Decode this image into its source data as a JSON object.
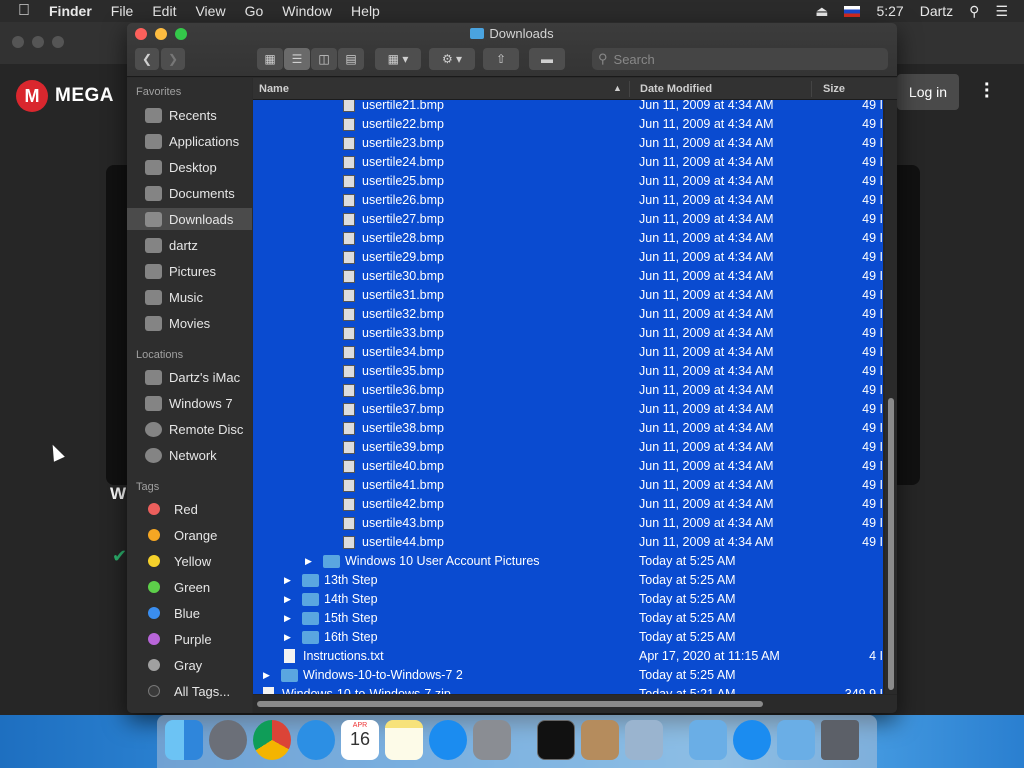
{
  "menubar": {
    "apple_icon": "apple-icon",
    "app_name": "Finder",
    "menus": [
      "File",
      "Edit",
      "View",
      "Go",
      "Window",
      "Help"
    ],
    "time": "5:27",
    "user": "Dartz"
  },
  "browser": {
    "logo_letter": "M",
    "logo_text": "MEGA",
    "login_label": "Log in",
    "panel_letter": "W"
  },
  "finder": {
    "title": "Downloads",
    "search_placeholder": "Search",
    "sidebar": {
      "favorites_header": "Favorites",
      "favorites": [
        "Recents",
        "Applications",
        "Desktop",
        "Documents",
        "Downloads",
        "dartz",
        "Pictures",
        "Music",
        "Movies"
      ],
      "selected": "Downloads",
      "locations_header": "Locations",
      "locations": [
        "Dartz's iMac",
        "Windows 7",
        "Remote Disc",
        "Network"
      ],
      "tags_header": "Tags",
      "tags": [
        {
          "label": "Red",
          "color": "#ec5f5c"
        },
        {
          "label": "Orange",
          "color": "#f5a623"
        },
        {
          "label": "Yellow",
          "color": "#f5d12b"
        },
        {
          "label": "Green",
          "color": "#5dcf4a"
        },
        {
          "label": "Blue",
          "color": "#3a8ef0"
        },
        {
          "label": "Purple",
          "color": "#b865d9"
        },
        {
          "label": "Gray",
          "color": "#a0a0a0"
        },
        {
          "label": "All Tags...",
          "color": "#3a3a3a"
        }
      ]
    },
    "columns": {
      "name": "Name",
      "date": "Date Modified",
      "size": "Size"
    },
    "rows": [
      {
        "name": "usertile21.bmp",
        "date": "Jun 11, 2009 at 4:34 AM",
        "size": "49 I",
        "kind": "file",
        "level": 3
      },
      {
        "name": "usertile22.bmp",
        "date": "Jun 11, 2009 at 4:34 AM",
        "size": "49 I",
        "kind": "file",
        "level": 3
      },
      {
        "name": "usertile23.bmp",
        "date": "Jun 11, 2009 at 4:34 AM",
        "size": "49 I",
        "kind": "file",
        "level": 3
      },
      {
        "name": "usertile24.bmp",
        "date": "Jun 11, 2009 at 4:34 AM",
        "size": "49 I",
        "kind": "file",
        "level": 3
      },
      {
        "name": "usertile25.bmp",
        "date": "Jun 11, 2009 at 4:34 AM",
        "size": "49 I",
        "kind": "file",
        "level": 3
      },
      {
        "name": "usertile26.bmp",
        "date": "Jun 11, 2009 at 4:34 AM",
        "size": "49 I",
        "kind": "file",
        "level": 3
      },
      {
        "name": "usertile27.bmp",
        "date": "Jun 11, 2009 at 4:34 AM",
        "size": "49 I",
        "kind": "file",
        "level": 3
      },
      {
        "name": "usertile28.bmp",
        "date": "Jun 11, 2009 at 4:34 AM",
        "size": "49 I",
        "kind": "file",
        "level": 3
      },
      {
        "name": "usertile29.bmp",
        "date": "Jun 11, 2009 at 4:34 AM",
        "size": "49 I",
        "kind": "file",
        "level": 3
      },
      {
        "name": "usertile30.bmp",
        "date": "Jun 11, 2009 at 4:34 AM",
        "size": "49 I",
        "kind": "file",
        "level": 3
      },
      {
        "name": "usertile31.bmp",
        "date": "Jun 11, 2009 at 4:34 AM",
        "size": "49 I",
        "kind": "file",
        "level": 3
      },
      {
        "name": "usertile32.bmp",
        "date": "Jun 11, 2009 at 4:34 AM",
        "size": "49 I",
        "kind": "file",
        "level": 3
      },
      {
        "name": "usertile33.bmp",
        "date": "Jun 11, 2009 at 4:34 AM",
        "size": "49 I",
        "kind": "file",
        "level": 3
      },
      {
        "name": "usertile34.bmp",
        "date": "Jun 11, 2009 at 4:34 AM",
        "size": "49 I",
        "kind": "file",
        "level": 3
      },
      {
        "name": "usertile35.bmp",
        "date": "Jun 11, 2009 at 4:34 AM",
        "size": "49 I",
        "kind": "file",
        "level": 3
      },
      {
        "name": "usertile36.bmp",
        "date": "Jun 11, 2009 at 4:34 AM",
        "size": "49 I",
        "kind": "file",
        "level": 3
      },
      {
        "name": "usertile37.bmp",
        "date": "Jun 11, 2009 at 4:34 AM",
        "size": "49 I",
        "kind": "file",
        "level": 3
      },
      {
        "name": "usertile38.bmp",
        "date": "Jun 11, 2009 at 4:34 AM",
        "size": "49 I",
        "kind": "file",
        "level": 3
      },
      {
        "name": "usertile39.bmp",
        "date": "Jun 11, 2009 at 4:34 AM",
        "size": "49 I",
        "kind": "file",
        "level": 3
      },
      {
        "name": "usertile40.bmp",
        "date": "Jun 11, 2009 at 4:34 AM",
        "size": "49 I",
        "kind": "file",
        "level": 3
      },
      {
        "name": "usertile41.bmp",
        "date": "Jun 11, 2009 at 4:34 AM",
        "size": "49 I",
        "kind": "file",
        "level": 3
      },
      {
        "name": "usertile42.bmp",
        "date": "Jun 11, 2009 at 4:34 AM",
        "size": "49 I",
        "kind": "file",
        "level": 3
      },
      {
        "name": "usertile43.bmp",
        "date": "Jun 11, 2009 at 4:34 AM",
        "size": "49 I",
        "kind": "file",
        "level": 3
      },
      {
        "name": "usertile44.bmp",
        "date": "Jun 11, 2009 at 4:34 AM",
        "size": "49 I",
        "kind": "file",
        "level": 3
      },
      {
        "name": "Windows 10 User Account Pictures",
        "date": "Today at 5:25 AM",
        "size": "",
        "kind": "folder",
        "level": 2
      },
      {
        "name": "13th Step",
        "date": "Today at 5:25 AM",
        "size": "",
        "kind": "folder",
        "level": 1
      },
      {
        "name": "14th Step",
        "date": "Today at 5:25 AM",
        "size": "",
        "kind": "folder",
        "level": 1
      },
      {
        "name": "15th Step",
        "date": "Today at 5:25 AM",
        "size": "",
        "kind": "folder",
        "level": 1
      },
      {
        "name": "16th Step",
        "date": "Today at 5:25 AM",
        "size": "",
        "kind": "folder",
        "level": 1
      },
      {
        "name": "Instructions.txt",
        "date": "Apr 17, 2020 at 11:15 AM",
        "size": "4 I",
        "kind": "text",
        "level": 1
      },
      {
        "name": "Windows-10-to-Windows-7 2",
        "date": "Today at 5:25 AM",
        "size": "",
        "kind": "folder",
        "level": 0
      },
      {
        "name": "Windows-10-to-Windows-7.zip",
        "date": "Today at 5:21 AM",
        "size": "349.9 I",
        "kind": "text",
        "level": 0
      }
    ]
  },
  "dock": {
    "apps": [
      "finder-icon",
      "launchpad-icon",
      "chrome-icon",
      "safari-icon",
      "calendar-icon",
      "notes-icon",
      "app-store-icon",
      "system-preferences-icon",
      "terminal-icon",
      "archive-utility-icon",
      "preview-icon",
      "applications-folder-icon",
      "app-store-download-icon",
      "downloads-folder-icon",
      "trash-icon"
    ],
    "calendar_month": "APR",
    "calendar_day": "16"
  }
}
